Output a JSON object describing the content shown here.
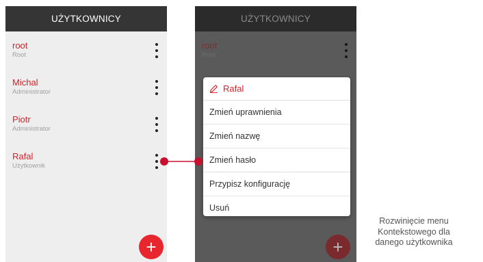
{
  "header": {
    "title": "UŻYTKOWNICY"
  },
  "users": [
    {
      "name": "root",
      "role": "Root"
    },
    {
      "name": "Michal",
      "role": "Administrator"
    },
    {
      "name": "Piotr",
      "role": "Administrator"
    },
    {
      "name": "Rafal",
      "role": "Użytkownik"
    }
  ],
  "context_menu": {
    "title": "Rafal",
    "items": [
      "Zmień uprawnienia",
      "Zmień nazwę",
      "Zmień hasło",
      "Przypisz konfigurację",
      "Usuń"
    ]
  },
  "fab": {
    "label": "+"
  },
  "caption": {
    "line1": "Rozwinięcie menu",
    "line2": "Kontekstowego dla",
    "line3": "danego użytkownika"
  },
  "colors": {
    "accent": "#e8262e",
    "header": "#353535",
    "connector": "#c8102e"
  },
  "icons": {
    "menu": "more-vert-icon",
    "edit": "pencil-icon",
    "add": "plus-icon"
  }
}
